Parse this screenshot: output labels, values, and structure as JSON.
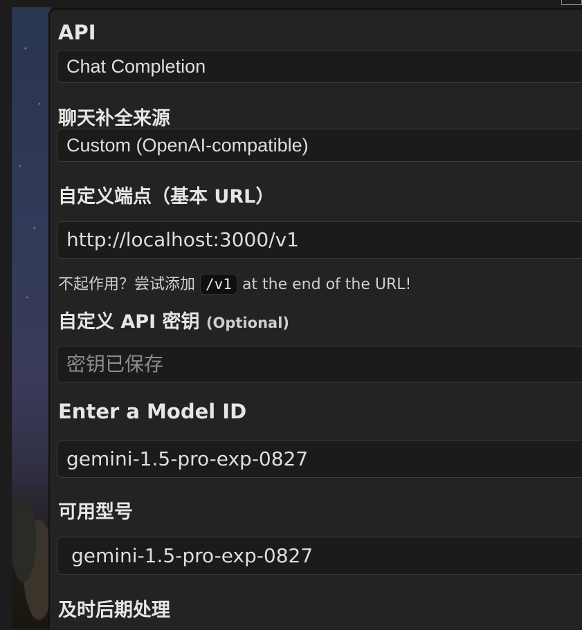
{
  "api": {
    "label": "API",
    "selected": "Chat Completion"
  },
  "chat_source": {
    "label": "聊天补全来源",
    "selected": "Custom (OpenAI-compatible)"
  },
  "endpoint": {
    "label": "自定义端点（基本 URL）",
    "value": "http://localhost:3000/v1",
    "hint_prefix": "不起作用？尝试添加",
    "hint_code": "/v1",
    "hint_suffix": "at the end of the URL!"
  },
  "api_key": {
    "label": "自定义 API 密钥",
    "optional": "(Optional)",
    "placeholder": "密钥已保存"
  },
  "model_id": {
    "label": "Enter a Model ID",
    "value": "gemini-1.5-pro-exp-0827"
  },
  "available_models": {
    "label": "可用型号",
    "selected": "gemini-1.5-pro-exp-0827"
  },
  "postprocessing": {
    "label": "及时后期处理"
  }
}
